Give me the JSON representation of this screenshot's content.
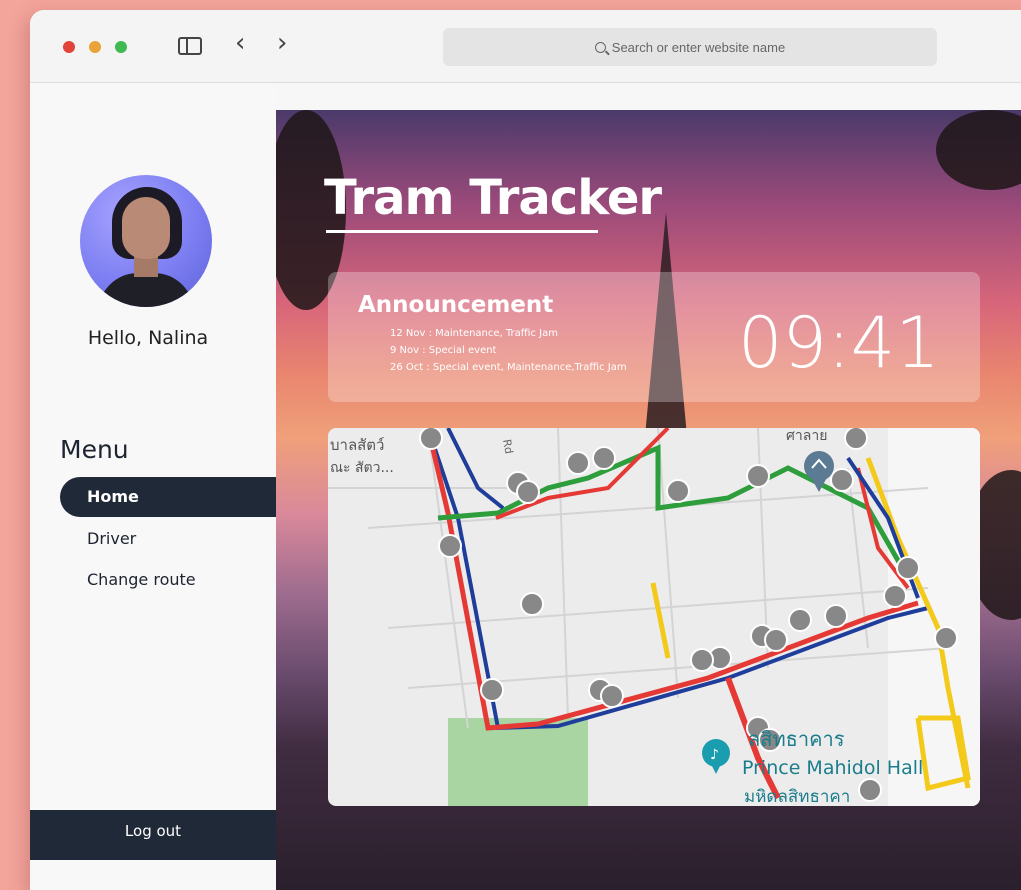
{
  "browser": {
    "address_placeholder": "Search or enter website name"
  },
  "sidebar": {
    "greeting": "Hello, Nalina",
    "menu_title": "Menu",
    "items": [
      {
        "label": "Home",
        "active": true
      },
      {
        "label": "Driver",
        "active": false
      },
      {
        "label": "Change route",
        "active": false
      }
    ],
    "logout_label": "Log out"
  },
  "main": {
    "title": "Tram Tracker",
    "announcement": {
      "title": "Announcement",
      "items": [
        "12 Nov : Maintenance, Traffic Jam",
        "9 Nov : Special event",
        "26 Oct : Special event, Maintenance,Traffic Jam"
      ]
    },
    "time": "09:41",
    "map": {
      "labels": {
        "top_left_1": "บาลสัตว์",
        "top_left_2": "ณะ สัตว...",
        "road": "Rd",
        "top_right": "ศาลาย",
        "hall_thai": "ลสิทธาคาร",
        "hall_en": "Prince Mahidol Hall",
        "hall_thai_2": "มหิดลสิทธาคา"
      },
      "route_colors": {
        "red": "#e53935",
        "green": "#2e9e3c",
        "blue": "#1f3d9a",
        "yellow": "#f3c91a"
      }
    }
  },
  "colors": {
    "dark": "#1f2937",
    "page_bg": "#f3a49b"
  }
}
